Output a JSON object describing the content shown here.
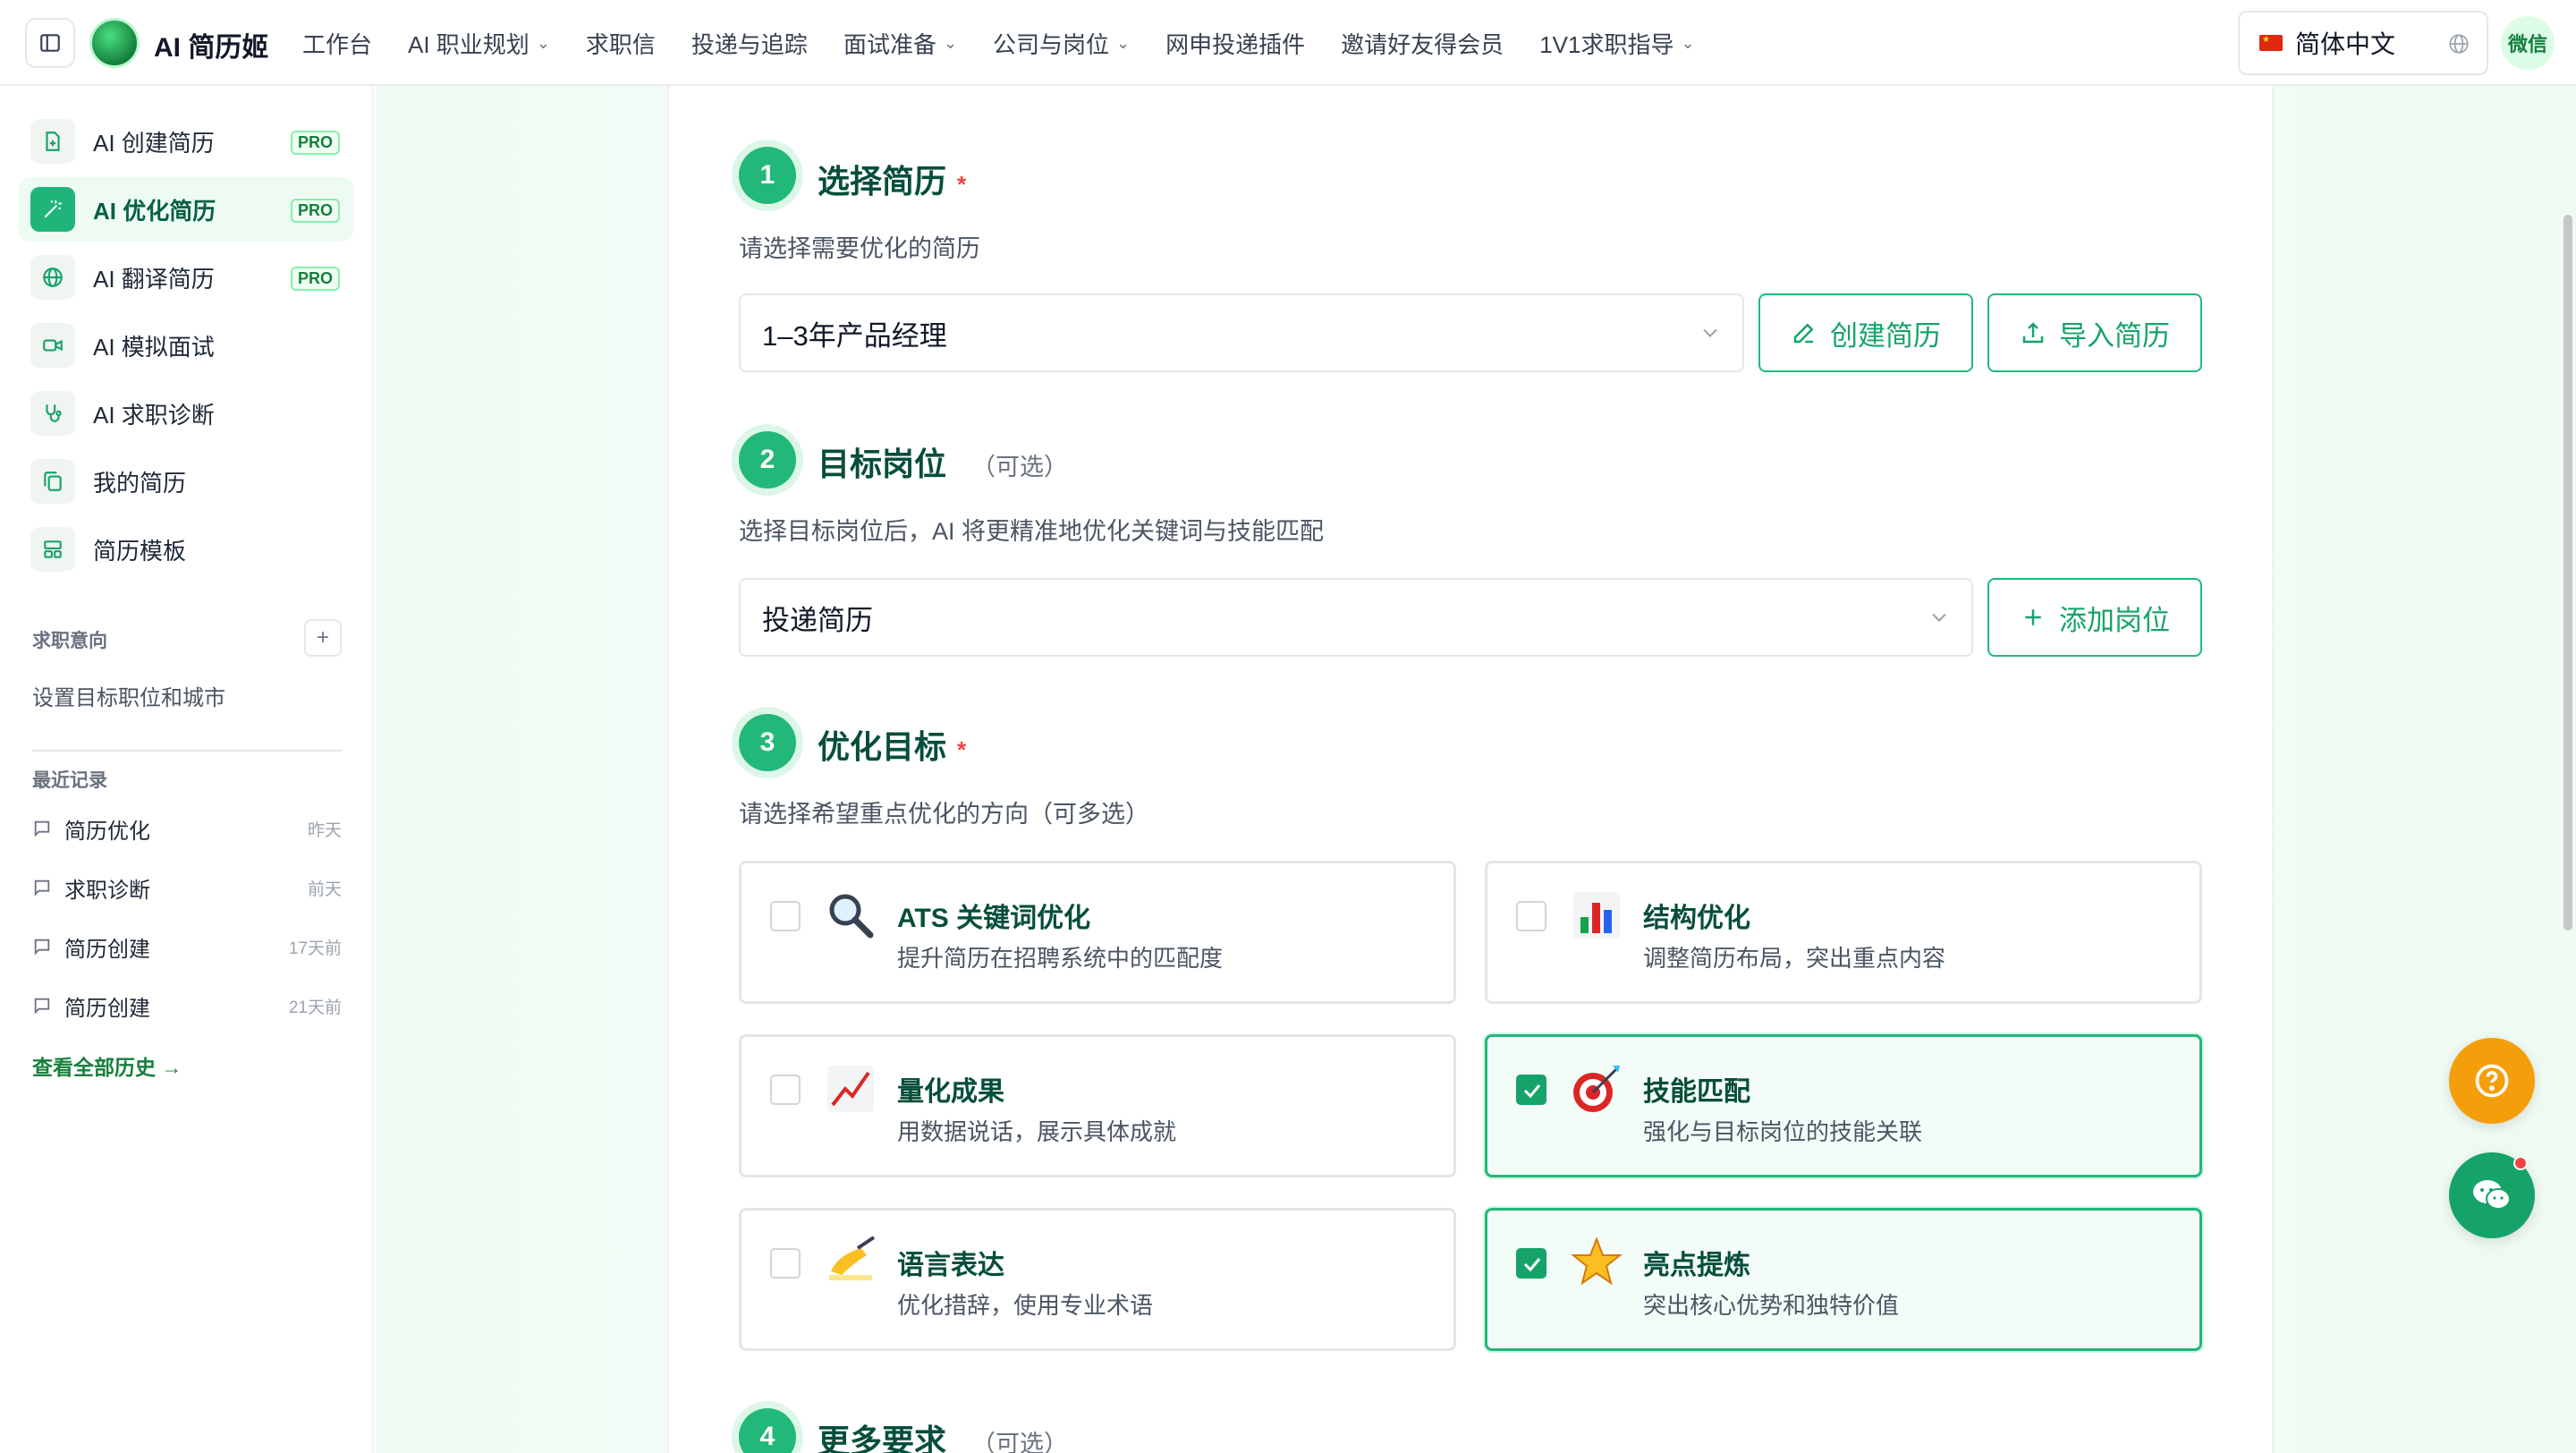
{
  "header": {
    "brand": "AI 简历姬",
    "nav": [
      {
        "label": "工作台",
        "dropdown": false
      },
      {
        "label": "AI 职业规划",
        "dropdown": true
      },
      {
        "label": "求职信",
        "dropdown": false
      },
      {
        "label": "投递与追踪",
        "dropdown": false
      },
      {
        "label": "面试准备",
        "dropdown": true
      },
      {
        "label": "公司与岗位",
        "dropdown": true
      },
      {
        "label": "网申投递插件",
        "dropdown": false
      },
      {
        "label": "邀请好友得会员",
        "dropdown": false
      },
      {
        "label": "1V1求职指导",
        "dropdown": true
      }
    ],
    "language": "简体中文",
    "wechat_badge": "微信"
  },
  "sidebar": {
    "items": [
      {
        "label": "AI 创建简历",
        "badge": "PRO",
        "icon": "file-plus-icon"
      },
      {
        "label": "AI 优化简历",
        "badge": "PRO",
        "icon": "magic-wand-icon",
        "active": true
      },
      {
        "label": "AI 翻译简历",
        "badge": "PRO",
        "icon": "globe-icon"
      },
      {
        "label": "AI 模拟面试",
        "badge": "",
        "icon": "video-icon"
      },
      {
        "label": "AI 求职诊断",
        "badge": "",
        "icon": "stethoscope-icon"
      },
      {
        "label": "我的简历",
        "badge": "",
        "icon": "copy-icon"
      },
      {
        "label": "简历模板",
        "badge": "",
        "icon": "layout-icon"
      }
    ],
    "intent": {
      "title": "求职意向",
      "text": "设置目标职位和城市"
    },
    "recent": {
      "title": "最近记录",
      "items": [
        {
          "label": "简历优化",
          "time": "昨天"
        },
        {
          "label": "求职诊断",
          "time": "前天"
        },
        {
          "label": "简历创建",
          "time": "17天前"
        },
        {
          "label": "简历创建",
          "time": "21天前"
        }
      ],
      "view_all": "查看全部历史 →"
    }
  },
  "steps": {
    "s1": {
      "num": "1",
      "title": "选择简历",
      "required": "*",
      "desc": "请选择需要优化的简历",
      "select_value": "1–3年产品经理",
      "btn_create": "创建简历",
      "btn_import": "导入简历"
    },
    "s2": {
      "num": "2",
      "title": "目标岗位",
      "optional": "（可选）",
      "desc": "选择目标岗位后，AI 将更精准地优化关键词与技能匹配",
      "select_value": "投递简历",
      "btn_add": "添加岗位"
    },
    "s3": {
      "num": "3",
      "title": "优化目标",
      "required": "*",
      "desc": "请选择希望重点优化的方向（可多选）",
      "options": [
        {
          "title": "ATS 关键词优化",
          "desc": "提升简历在招聘系统中的匹配度",
          "icon": "magnifier-icon",
          "checked": false
        },
        {
          "title": "结构优化",
          "desc": "调整简历布局，突出重点内容",
          "icon": "bar-chart-icon",
          "checked": false
        },
        {
          "title": "量化成果",
          "desc": "用数据说话，展示具体成就",
          "icon": "trend-chart-icon",
          "checked": false
        },
        {
          "title": "技能匹配",
          "desc": "强化与目标岗位的技能关联",
          "icon": "target-icon",
          "checked": true
        },
        {
          "title": "语言表达",
          "desc": "优化措辞，使用专业术语",
          "icon": "writing-hand-icon",
          "checked": false
        },
        {
          "title": "亮点提炼",
          "desc": "突出核心优势和独特价值",
          "icon": "star-icon",
          "checked": true
        }
      ]
    },
    "s4": {
      "num": "4",
      "title": "更多要求",
      "optional": "（可选）"
    }
  },
  "colors": {
    "accent": "#22b87a",
    "accent_dark": "#064e3b",
    "warning": "#f59e0b",
    "required": "#ef4444"
  }
}
